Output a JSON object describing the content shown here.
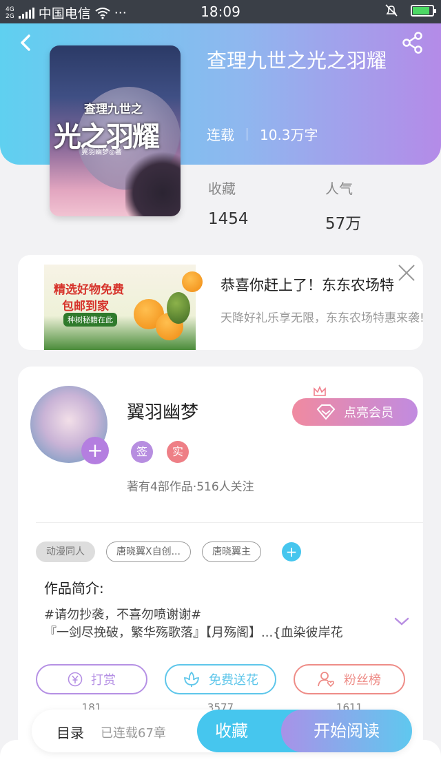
{
  "status_bar": {
    "network_top": "4G",
    "network_bottom": "2G",
    "carrier": "中国电信",
    "more": "···",
    "time": "18:09",
    "battery_level": 0.85
  },
  "book": {
    "title": "查理九世之光之羽耀",
    "status": "连载",
    "word_count": "10.3万字",
    "cover": {
      "series": "查理九世之",
      "title": "光之羽耀",
      "author": "翼羽幽梦◎著"
    },
    "stats": {
      "favorites_label": "收藏",
      "favorites_value": "1454",
      "popularity_label": "人气",
      "popularity_value": "57万"
    }
  },
  "ad": {
    "image": {
      "line1": "精选好物免费",
      "line2": "包邮到家",
      "line3": "种树秘籍在此"
    },
    "title": "恭喜你赶上了！东东农场特",
    "description": "天降好礼乐享无限，东东农场特惠来袭!"
  },
  "author": {
    "name": "翼羽幽梦",
    "badges": [
      "签",
      "实"
    ],
    "works_info": "著有4部作品·516人关注",
    "vip_button": "点亮会员",
    "tags": [
      "动漫同人",
      "唐晓翼X自创...",
      "唐晓翼主"
    ],
    "intro_label": "作品简介:",
    "intro_lines": [
      "#请勿抄袭，不喜勿喷谢谢#",
      "『一剑尽挽破，繁华殇歌落』【月殇阁】...{血染彼岸花"
    ]
  },
  "actions": [
    {
      "label": "打赏",
      "count": "181",
      "color": "#b590e4"
    },
    {
      "label": "免费送花",
      "count": "3577",
      "color": "#5ec6ea"
    },
    {
      "label": "粉丝榜",
      "count": "1611",
      "color": "#ee8c87"
    }
  ],
  "bottom_bar": {
    "toc_label": "目录",
    "chapter_count": "已连载67章",
    "collect_label": "收藏",
    "read_label": "开始阅读"
  },
  "colors": {
    "header_start": "#5fd0f0",
    "header_end": "#b48be8",
    "accent_blue": "#46c6ee",
    "accent_purple": "#b47ee0"
  }
}
